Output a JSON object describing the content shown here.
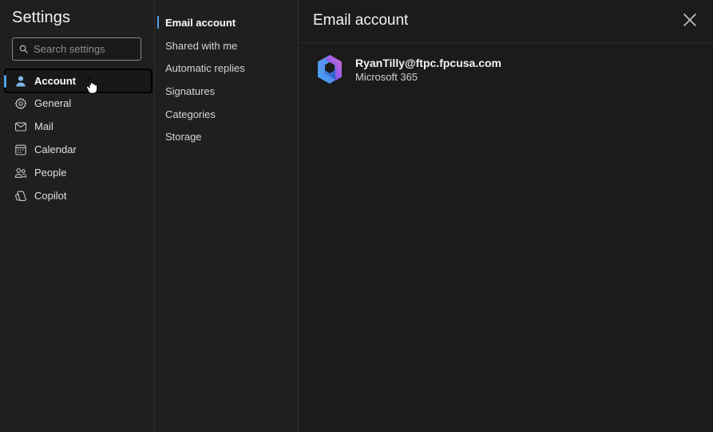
{
  "left": {
    "title": "Settings",
    "search_placeholder": "Search settings",
    "nav": [
      {
        "label": "Account",
        "icon": "person-icon"
      },
      {
        "label": "General",
        "icon": "gear-icon"
      },
      {
        "label": "Mail",
        "icon": "mail-icon"
      },
      {
        "label": "Calendar",
        "icon": "calendar-icon"
      },
      {
        "label": "People",
        "icon": "people-icon"
      },
      {
        "label": "Copilot",
        "icon": "copilot-icon"
      }
    ],
    "selected_index": 0
  },
  "middle": {
    "items": [
      {
        "label": "Email account"
      },
      {
        "label": "Shared with me"
      },
      {
        "label": "Automatic replies"
      },
      {
        "label": "Signatures"
      },
      {
        "label": "Categories"
      },
      {
        "label": "Storage"
      }
    ],
    "selected_index": 0
  },
  "main": {
    "title": "Email account",
    "account": {
      "email": "RyanTilly@ftpc.fpcusa.com",
      "type": "Microsoft 365",
      "logo": "microsoft-365-logo"
    }
  },
  "colors": {
    "accent": "#4f9fe8",
    "background": "#1b1a19",
    "pane": "#1f1f1f",
    "text": "#e1dfdd"
  }
}
